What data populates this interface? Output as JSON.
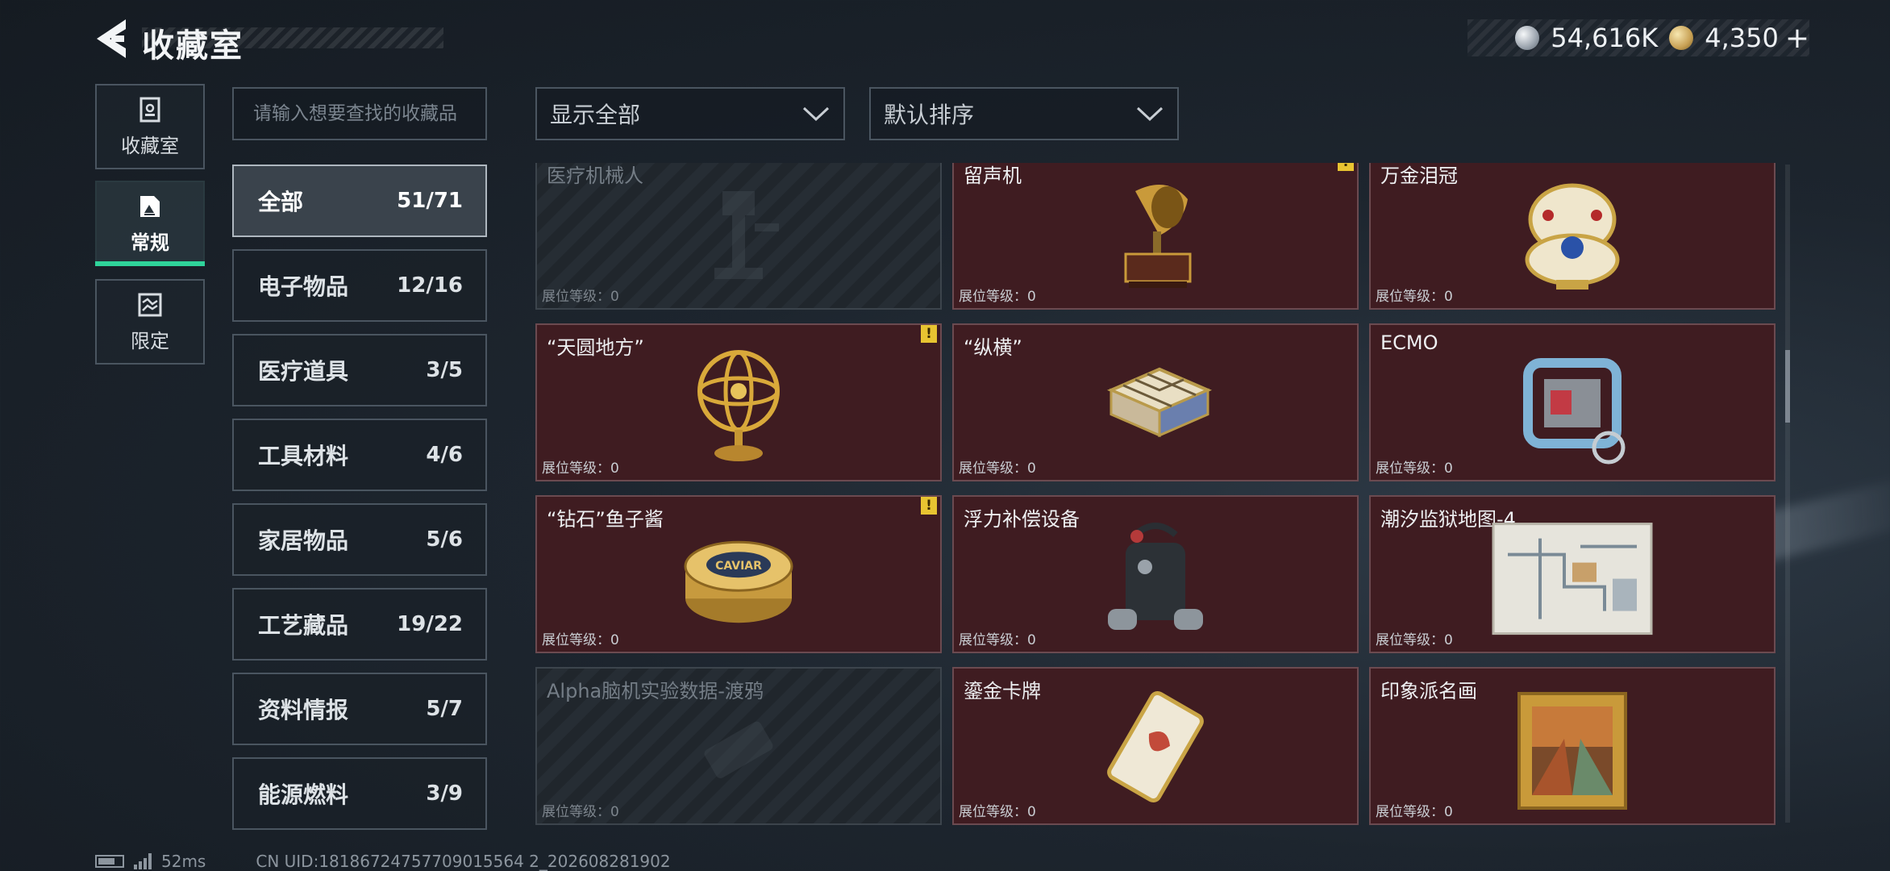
{
  "header": {
    "title": "收藏室",
    "silver_amount": "54,616K",
    "gold_amount": "4,350",
    "add_label": "+"
  },
  "side_tabs": [
    {
      "label": "收藏室",
      "icon": "archive-icon"
    },
    {
      "label": "常规",
      "icon": "gallery-icon",
      "active": true
    },
    {
      "label": "限定",
      "icon": "limited-icon"
    }
  ],
  "search": {
    "placeholder": "请输入想要查找的收藏品"
  },
  "filters": {
    "show": "显示全部",
    "sort": "默认排序"
  },
  "categories": [
    {
      "name": "全部",
      "count": "51/71",
      "active": true
    },
    {
      "name": "电子物品",
      "count": "12/16"
    },
    {
      "name": "医疗道具",
      "count": "3/5"
    },
    {
      "name": "工具材料",
      "count": "4/6"
    },
    {
      "name": "家居物品",
      "count": "5/6"
    },
    {
      "name": "工艺藏品",
      "count": "19/22"
    },
    {
      "name": "资料情报",
      "count": "5/7"
    },
    {
      "name": "能源燃料",
      "count": "3/9"
    }
  ],
  "cards": [
    {
      "name": "医疗机械人",
      "level": "展位等级：0",
      "locked": true
    },
    {
      "name": "留声机",
      "level": "展位等级：0",
      "alert": "!"
    },
    {
      "name": "万金泪冠",
      "level": "展位等级：0"
    },
    {
      "name": "“天圆地方”",
      "level": "展位等级：0",
      "alert": "!"
    },
    {
      "name": "“纵横”",
      "level": "展位等级：0"
    },
    {
      "name": "ECMO",
      "level": "展位等级：0"
    },
    {
      "name": "“钻石”鱼子酱",
      "level": "展位等级：0",
      "alert": "!",
      "caviar_label": "CAVIAR"
    },
    {
      "name": "浮力补偿设备",
      "level": "展位等级：0"
    },
    {
      "name": "潮汐监狱地图-4",
      "level": "展位等级：0"
    },
    {
      "name": "Alpha脑机实验数据-渡鸦",
      "level": "展位等级：0",
      "locked": true
    },
    {
      "name": "鎏金卡牌",
      "level": "展位等级：0"
    },
    {
      "name": "印象派名画",
      "level": "展位等级：0"
    }
  ],
  "footer": {
    "ping": "52ms",
    "uid": "CN UID:18186724757709015564 2_202608281902"
  }
}
